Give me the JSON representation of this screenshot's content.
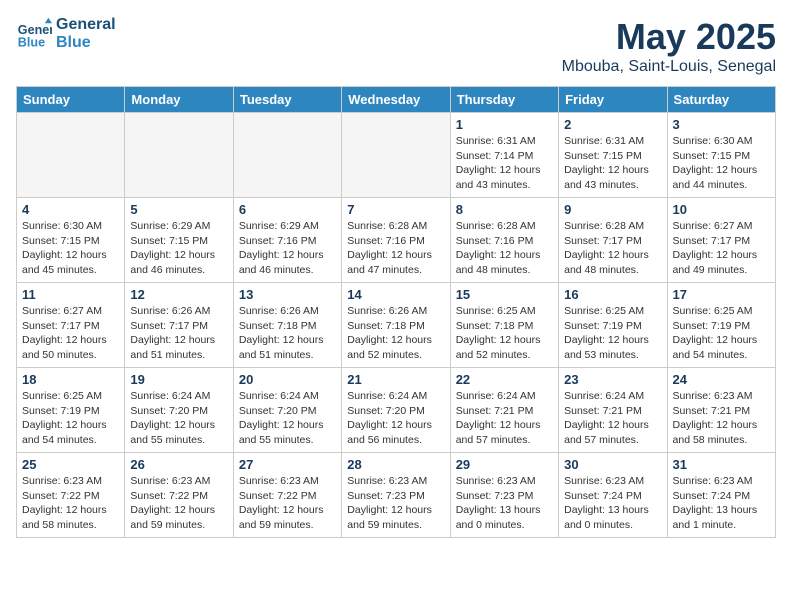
{
  "header": {
    "logo_line1": "General",
    "logo_line2": "Blue",
    "month": "May 2025",
    "location": "Mbouba, Saint-Louis, Senegal"
  },
  "weekdays": [
    "Sunday",
    "Monday",
    "Tuesday",
    "Wednesday",
    "Thursday",
    "Friday",
    "Saturday"
  ],
  "weeks": [
    {
      "row_class": "row-odd",
      "days": [
        {
          "num": "",
          "info": "",
          "empty": true
        },
        {
          "num": "",
          "info": "",
          "empty": true
        },
        {
          "num": "",
          "info": "",
          "empty": true
        },
        {
          "num": "",
          "info": "",
          "empty": true
        },
        {
          "num": "1",
          "info": "Sunrise: 6:31 AM\nSunset: 7:14 PM\nDaylight: 12 hours\nand 43 minutes.",
          "empty": false
        },
        {
          "num": "2",
          "info": "Sunrise: 6:31 AM\nSunset: 7:15 PM\nDaylight: 12 hours\nand 43 minutes.",
          "empty": false
        },
        {
          "num": "3",
          "info": "Sunrise: 6:30 AM\nSunset: 7:15 PM\nDaylight: 12 hours\nand 44 minutes.",
          "empty": false
        }
      ]
    },
    {
      "row_class": "row-even",
      "days": [
        {
          "num": "4",
          "info": "Sunrise: 6:30 AM\nSunset: 7:15 PM\nDaylight: 12 hours\nand 45 minutes.",
          "empty": false
        },
        {
          "num": "5",
          "info": "Sunrise: 6:29 AM\nSunset: 7:15 PM\nDaylight: 12 hours\nand 46 minutes.",
          "empty": false
        },
        {
          "num": "6",
          "info": "Sunrise: 6:29 AM\nSunset: 7:16 PM\nDaylight: 12 hours\nand 46 minutes.",
          "empty": false
        },
        {
          "num": "7",
          "info": "Sunrise: 6:28 AM\nSunset: 7:16 PM\nDaylight: 12 hours\nand 47 minutes.",
          "empty": false
        },
        {
          "num": "8",
          "info": "Sunrise: 6:28 AM\nSunset: 7:16 PM\nDaylight: 12 hours\nand 48 minutes.",
          "empty": false
        },
        {
          "num": "9",
          "info": "Sunrise: 6:28 AM\nSunset: 7:17 PM\nDaylight: 12 hours\nand 48 minutes.",
          "empty": false
        },
        {
          "num": "10",
          "info": "Sunrise: 6:27 AM\nSunset: 7:17 PM\nDaylight: 12 hours\nand 49 minutes.",
          "empty": false
        }
      ]
    },
    {
      "row_class": "row-odd",
      "days": [
        {
          "num": "11",
          "info": "Sunrise: 6:27 AM\nSunset: 7:17 PM\nDaylight: 12 hours\nand 50 minutes.",
          "empty": false
        },
        {
          "num": "12",
          "info": "Sunrise: 6:26 AM\nSunset: 7:17 PM\nDaylight: 12 hours\nand 51 minutes.",
          "empty": false
        },
        {
          "num": "13",
          "info": "Sunrise: 6:26 AM\nSunset: 7:18 PM\nDaylight: 12 hours\nand 51 minutes.",
          "empty": false
        },
        {
          "num": "14",
          "info": "Sunrise: 6:26 AM\nSunset: 7:18 PM\nDaylight: 12 hours\nand 52 minutes.",
          "empty": false
        },
        {
          "num": "15",
          "info": "Sunrise: 6:25 AM\nSunset: 7:18 PM\nDaylight: 12 hours\nand 52 minutes.",
          "empty": false
        },
        {
          "num": "16",
          "info": "Sunrise: 6:25 AM\nSunset: 7:19 PM\nDaylight: 12 hours\nand 53 minutes.",
          "empty": false
        },
        {
          "num": "17",
          "info": "Sunrise: 6:25 AM\nSunset: 7:19 PM\nDaylight: 12 hours\nand 54 minutes.",
          "empty": false
        }
      ]
    },
    {
      "row_class": "row-even",
      "days": [
        {
          "num": "18",
          "info": "Sunrise: 6:25 AM\nSunset: 7:19 PM\nDaylight: 12 hours\nand 54 minutes.",
          "empty": false
        },
        {
          "num": "19",
          "info": "Sunrise: 6:24 AM\nSunset: 7:20 PM\nDaylight: 12 hours\nand 55 minutes.",
          "empty": false
        },
        {
          "num": "20",
          "info": "Sunrise: 6:24 AM\nSunset: 7:20 PM\nDaylight: 12 hours\nand 55 minutes.",
          "empty": false
        },
        {
          "num": "21",
          "info": "Sunrise: 6:24 AM\nSunset: 7:20 PM\nDaylight: 12 hours\nand 56 minutes.",
          "empty": false
        },
        {
          "num": "22",
          "info": "Sunrise: 6:24 AM\nSunset: 7:21 PM\nDaylight: 12 hours\nand 57 minutes.",
          "empty": false
        },
        {
          "num": "23",
          "info": "Sunrise: 6:24 AM\nSunset: 7:21 PM\nDaylight: 12 hours\nand 57 minutes.",
          "empty": false
        },
        {
          "num": "24",
          "info": "Sunrise: 6:23 AM\nSunset: 7:21 PM\nDaylight: 12 hours\nand 58 minutes.",
          "empty": false
        }
      ]
    },
    {
      "row_class": "row-odd",
      "days": [
        {
          "num": "25",
          "info": "Sunrise: 6:23 AM\nSunset: 7:22 PM\nDaylight: 12 hours\nand 58 minutes.",
          "empty": false
        },
        {
          "num": "26",
          "info": "Sunrise: 6:23 AM\nSunset: 7:22 PM\nDaylight: 12 hours\nand 59 minutes.",
          "empty": false
        },
        {
          "num": "27",
          "info": "Sunrise: 6:23 AM\nSunset: 7:22 PM\nDaylight: 12 hours\nand 59 minutes.",
          "empty": false
        },
        {
          "num": "28",
          "info": "Sunrise: 6:23 AM\nSunset: 7:23 PM\nDaylight: 12 hours\nand 59 minutes.",
          "empty": false
        },
        {
          "num": "29",
          "info": "Sunrise: 6:23 AM\nSunset: 7:23 PM\nDaylight: 13 hours\nand 0 minutes.",
          "empty": false
        },
        {
          "num": "30",
          "info": "Sunrise: 6:23 AM\nSunset: 7:24 PM\nDaylight: 13 hours\nand 0 minutes.",
          "empty": false
        },
        {
          "num": "31",
          "info": "Sunrise: 6:23 AM\nSunset: 7:24 PM\nDaylight: 13 hours\nand 1 minute.",
          "empty": false
        }
      ]
    }
  ]
}
